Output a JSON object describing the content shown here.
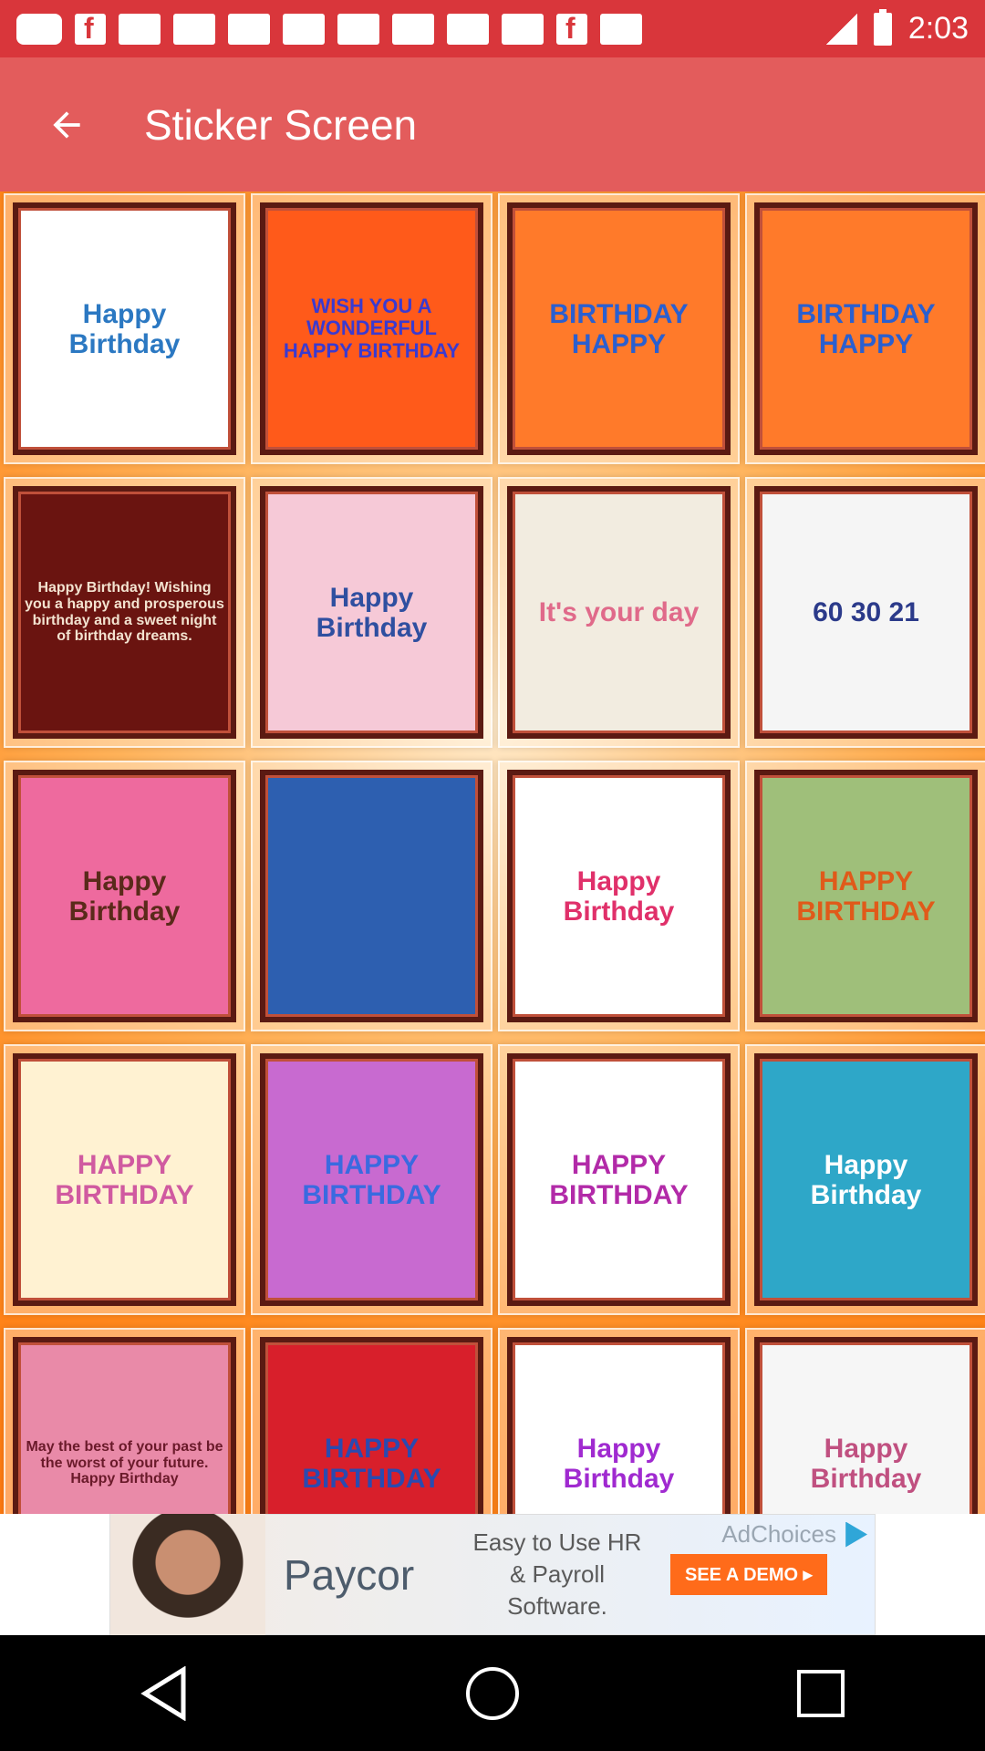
{
  "status_bar": {
    "time": "2:03",
    "icons": [
      "message-icon",
      "facebook-icon",
      "notification-icon",
      "notification-icon",
      "notification-icon",
      "notification-icon",
      "notification-icon",
      "notification-icon",
      "notification-icon",
      "notification-icon",
      "facebook-icon",
      "notification-icon",
      "signal-icon",
      "battery-icon"
    ]
  },
  "app_bar": {
    "title": "Sticker Screen",
    "back_icon": "arrow-back-icon"
  },
  "stickers": [
    {
      "label": "Happy Birthday",
      "bg": "#ffffff",
      "fg": "#2b78c2"
    },
    {
      "label": "WISH YOU A WONDERFUL HAPPY BIRTHDAY",
      "bg": "#ff5a1a",
      "fg": "#3a3ad0"
    },
    {
      "label": "BIRTHDAY HAPPY",
      "bg": "#ff7a2a",
      "fg": "#2a5fd0"
    },
    {
      "label": "BIRTHDAY HAPPY",
      "bg": "#ff7a2a",
      "fg": "#2a5fd0"
    },
    {
      "label": "Happy Birthday! Wishing you a happy and prosperous birthday and a sweet night of birthday dreams.",
      "bg": "#6a1410",
      "fg": "#f3e3d0"
    },
    {
      "label": "Happy Birthday",
      "bg": "#f6c9d7",
      "fg": "#2f4fa0"
    },
    {
      "label": "It's your day",
      "bg": "#f2ece0",
      "fg": "#e06a8a"
    },
    {
      "label": "60 30 21",
      "bg": "#f5f5f5",
      "fg": "#2b3a8a"
    },
    {
      "label": "Happy Birthday",
      "bg": "#ee6a9e",
      "fg": "#5a2a1a"
    },
    {
      "label": "",
      "bg": "#2d5fb0",
      "fg": "#ffffff"
    },
    {
      "label": "Happy Birthday",
      "bg": "#ffffff",
      "fg": "#e0306a"
    },
    {
      "label": "HAPPY BIRTHDAY",
      "bg": "#9fbf7a",
      "fg": "#e05a1a"
    },
    {
      "label": "HAPPY BIRTHDAY",
      "bg": "#fff2d2",
      "fg": "#d05aa0"
    },
    {
      "label": "HAPPY BIRTHDAY",
      "bg": "#c86ad0",
      "fg": "#3a6ae0"
    },
    {
      "label": "HAPPY BIRTHDAY",
      "bg": "#ffffff",
      "fg": "#b22aa8"
    },
    {
      "label": "Happy Birthday",
      "bg": "#2ea7c8",
      "fg": "#ffffff"
    },
    {
      "label": "May the best of your past be the worst of your future. Happy Birthday",
      "bg": "#e98aa8",
      "fg": "#6a1a2a"
    },
    {
      "label": "HAPPY BIRTHDAY",
      "bg": "#d81f2b",
      "fg": "#2a4ab0"
    },
    {
      "label": "Happy Birthday",
      "bg": "#ffffff",
      "fg": "#a02ad0"
    },
    {
      "label": "Happy Birthday",
      "bg": "#f6f6f6",
      "fg": "#c05080"
    }
  ],
  "ad": {
    "brand": "Paycor",
    "text": "Easy to Use HR & Payroll Software.",
    "cta": "SEE A DEMO ▸",
    "choices": "AdChoices"
  },
  "nav": {
    "back_icon": "nav-back-icon",
    "home_icon": "nav-home-icon",
    "recents_icon": "nav-recents-icon"
  }
}
